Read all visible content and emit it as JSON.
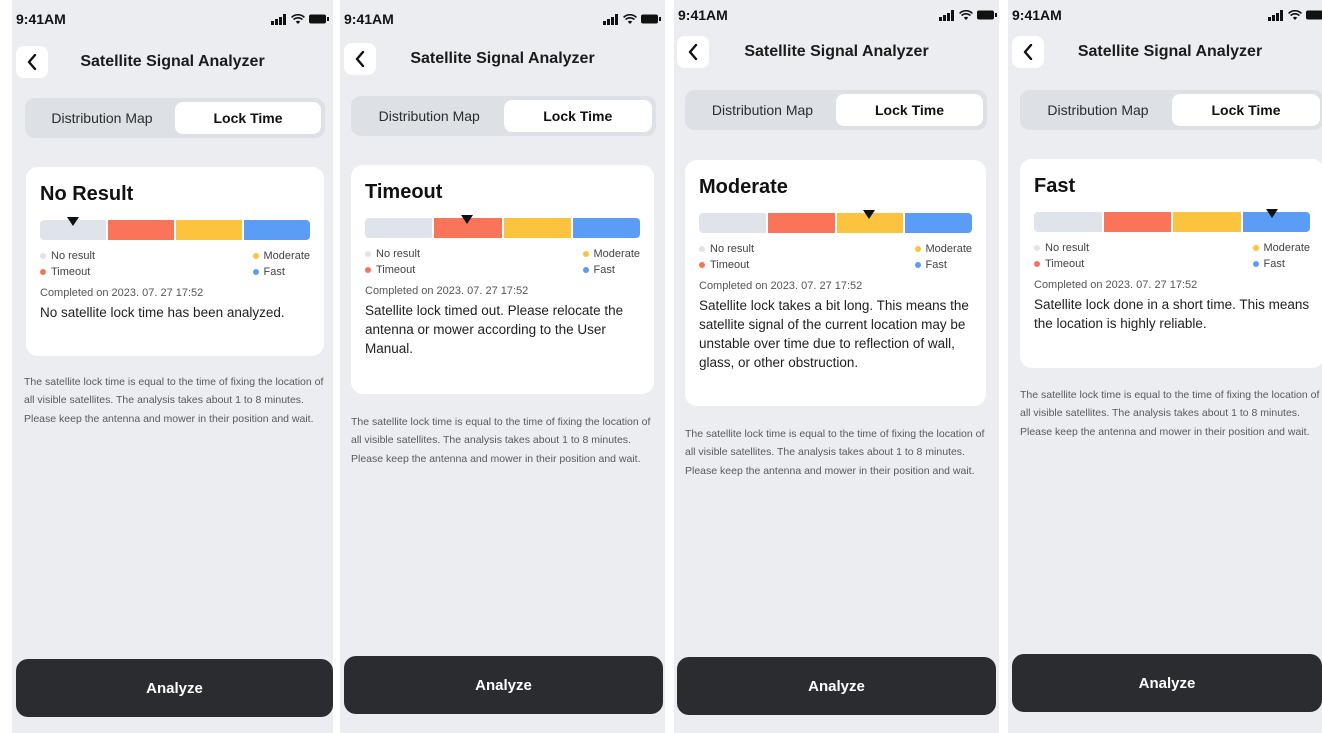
{
  "status_bar": {
    "time": "9:41AM"
  },
  "header": {
    "title": "Satellite Signal Analyzer"
  },
  "tabs": [
    "Distribution Map",
    "Lock Time"
  ],
  "legend": {
    "no_result": "No result",
    "timeout": "Timeout",
    "moderate": "Moderate",
    "fast": "Fast"
  },
  "colors": {
    "no_result": "#dfe3ea",
    "timeout": "#f97458",
    "moderate": "#fcc43e",
    "fast": "#5b9cf6",
    "button": "#2b2c30"
  },
  "icons": [
    "chevron-left-icon",
    "signal-icon",
    "wifi-icon",
    "battery-icon"
  ],
  "screens": [
    {
      "status": "No Result",
      "level": "no_result",
      "completed": "Completed on 2023. 07. 27  17:52",
      "message": "No satellite lock time has been analyzed."
    },
    {
      "status": "Timeout",
      "level": "timeout",
      "completed": "Completed on 2023. 07. 27  17:52",
      "message": "Satellite lock timed out. Please relocate the antenna or mower according to the User Manual."
    },
    {
      "status": "Moderate",
      "level": "moderate",
      "completed": "Completed on 2023. 07. 27  17:52",
      "message": "Satellite lock takes a bit long. This means the satellite signal of the current location may be unstable over time due to reflection of wall, glass, or other obstruction."
    },
    {
      "status": "Fast",
      "level": "fast",
      "completed": "Completed on 2023. 07. 27  17:52",
      "message": "Satellite lock done in a short time. This means the location is highly reliable."
    }
  ],
  "footnote": "The satellite lock time is equal to the time of fixing the location of all visible satellites. The analysis takes about 1 to 8 minutes. Please keep the antenna and mower in their position and wait.",
  "analyze_button": "Analyze"
}
